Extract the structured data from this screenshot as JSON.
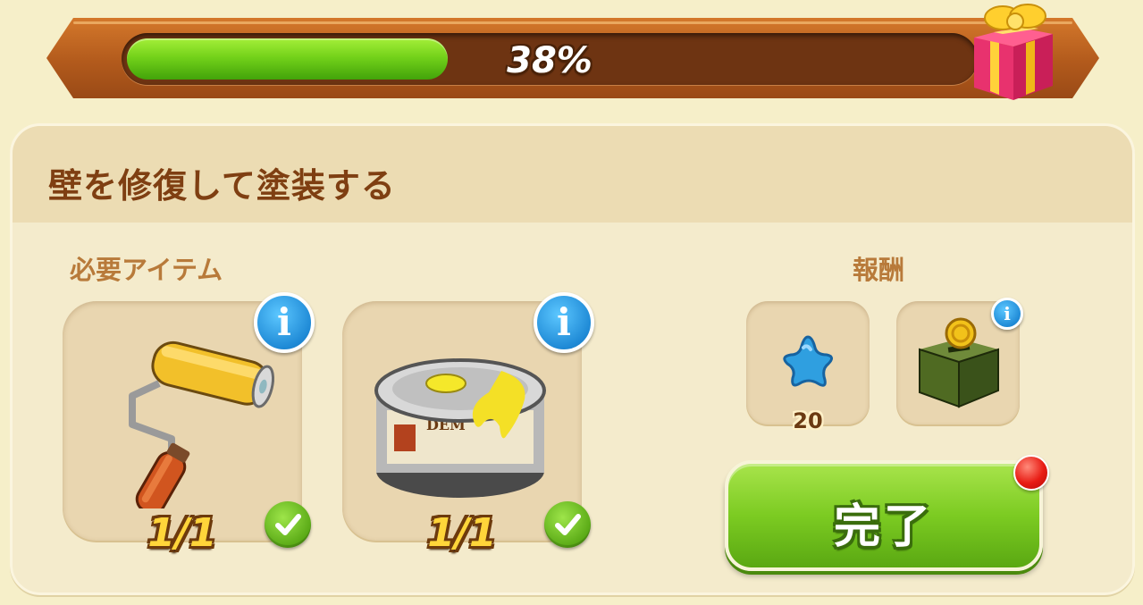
{
  "progress": {
    "percent": 38,
    "label": "38%",
    "reward_icon": "gift-box-icon"
  },
  "task": {
    "title": "壁を修復して塗装する",
    "required_label": "必要アイテム",
    "rewards_label": "報酬",
    "items": [
      {
        "icon": "paint-roller-icon",
        "count": "1/1",
        "complete": true
      },
      {
        "icon": "paint-can-icon",
        "count": "1/1",
        "complete": true
      }
    ],
    "rewards": [
      {
        "icon": "blue-star-icon",
        "amount": "20"
      },
      {
        "icon": "coin-box-icon",
        "amount": ""
      }
    ],
    "complete_button_label": "完了"
  },
  "colors": {
    "progress_fill": "#74d21a",
    "title_text": "#7f3f12",
    "info_badge": "#1f8ad6",
    "check_badge": "#5aaa16",
    "button_green": "#7ccb22",
    "notification": "#e81c14"
  }
}
